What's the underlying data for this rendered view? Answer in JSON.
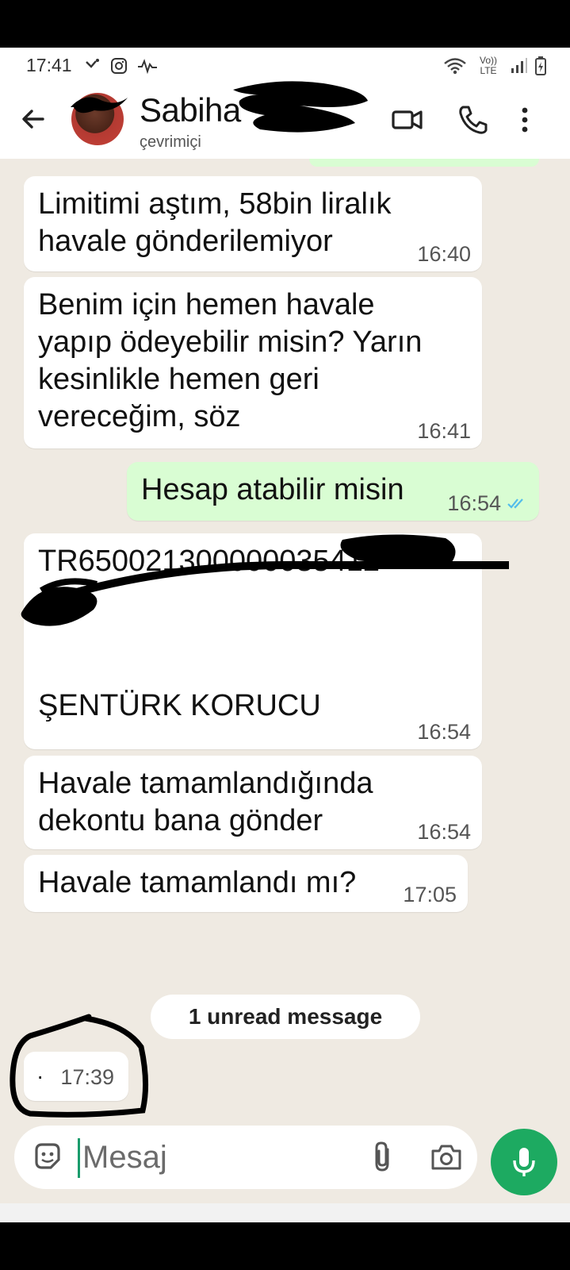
{
  "status_bar": {
    "time": "17:41",
    "network": "Vo)) LTE"
  },
  "header": {
    "contact_name": "Sabiha",
    "contact_status": "çevrimiçi"
  },
  "messages": [
    {
      "direction": "in",
      "lines": [
        "Limitimi aştım, 58bin liralık",
        "havale gönderilemiyor"
      ],
      "time": "16:40"
    },
    {
      "direction": "in",
      "lines": [
        "Benim için hemen havale",
        "yapıp ödeyebilir misin? Yarın",
        "kesinlikle hemen geri",
        "vereceğim, söz"
      ],
      "time": "16:41"
    },
    {
      "direction": "out",
      "lines": [
        "Hesap atabilir misin"
      ],
      "time": "16:54",
      "status": "read"
    },
    {
      "direction": "in",
      "lines": [
        "TR650021300000035412",
        "ŞENTÜRK KORUCU"
      ],
      "time": "16:54"
    },
    {
      "direction": "in",
      "lines": [
        "Havale tamamlandığında",
        "dekontu bana gönder"
      ],
      "time": "16:54"
    },
    {
      "direction": "in",
      "lines": [
        "Havale tamamlandı mı?"
      ],
      "time": "17:05"
    }
  ],
  "unread_banner": "1 unread message",
  "deleted_message": {
    "dot": "·",
    "time": "17:39"
  },
  "composer": {
    "placeholder": "Mesaj"
  },
  "colors": {
    "accent": "#1daa61",
    "incoming": "#ffffff",
    "outgoing": "#d9fdd3",
    "chat_bg": "#efeae2",
    "read_ticks": "#53bdeb"
  },
  "icons": [
    "back-arrow-icon",
    "video-call-icon",
    "phone-icon",
    "more-options-icon",
    "sticker-icon",
    "attach-icon",
    "camera-icon",
    "mic-icon",
    "recents-icon",
    "home-icon",
    "nav-back-icon"
  ]
}
